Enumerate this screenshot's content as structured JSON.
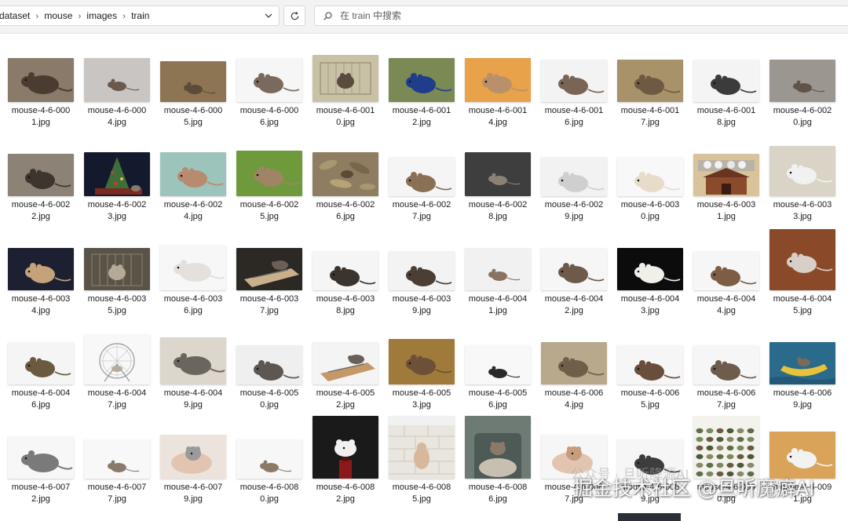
{
  "breadcrumb": [
    "dataset",
    "mouse",
    "images",
    "train"
  ],
  "search": {
    "placeholder": "在 train 中搜索"
  },
  "watermark": {
    "main": "掘金技术社区 @旦听魔癖AI",
    "faint": "公众号 · 旦听降源AI"
  },
  "files": [
    {
      "l1": "mouse-4-6-000",
      "l2": "1.jpg",
      "bg": "#8a7a69",
      "fg": "#4a3c30",
      "shape": "rat",
      "h": 56
    },
    {
      "l1": "mouse-4-6-000",
      "l2": "4.jpg",
      "bg": "#c9c5c2",
      "fg": "#6b5a4c",
      "shape": "mouse-small",
      "h": 56
    },
    {
      "l1": "mouse-4-6-000",
      "l2": "5.jpg",
      "bg": "#8d7553",
      "fg": "#5b4b38",
      "shape": "mouse-small",
      "h": 52
    },
    {
      "l1": "mouse-4-6-000",
      "l2": "6.jpg",
      "bg": "#f6f6f6",
      "fg": "#7a6a5d",
      "shape": "mouse",
      "h": 56
    },
    {
      "l1": "mouse-4-6-001",
      "l2": "0.jpg",
      "bg": "#c8c1a5",
      "fg": "#5b4a3e",
      "shape": "cage",
      "h": 60
    },
    {
      "l1": "mouse-4-6-001",
      "l2": "2.jpg",
      "bg": "#7b8a55",
      "fg": "#1f3d8a",
      "shape": "mouse",
      "h": 56
    },
    {
      "l1": "mouse-4-6-001",
      "l2": "4.jpg",
      "bg": "#e8a24a",
      "fg": "#b8906a",
      "shape": "mouse",
      "h": 56
    },
    {
      "l1": "mouse-4-6-001",
      "l2": "6.jpg",
      "bg": "#f3f3f3",
      "fg": "#7a6555",
      "shape": "mouse",
      "h": 54
    },
    {
      "l1": "mouse-4-6-001",
      "l2": "7.jpg",
      "bg": "#a8926a",
      "fg": "#6e5a44",
      "shape": "mouse",
      "h": 54
    },
    {
      "l1": "mouse-4-6-001",
      "l2": "8.jpg",
      "bg": "#f4f4f4",
      "fg": "#3b3b3b",
      "shape": "mouse",
      "h": 54
    },
    {
      "l1": "mouse-4-6-002",
      "l2": "0.jpg",
      "bg": "#9b9690",
      "fg": "#5e5448",
      "shape": "mouse-small",
      "h": 54
    },
    {
      "l1": "mouse-4-6-002",
      "l2": "2.jpg",
      "bg": "#8c8275",
      "fg": "#3d362f",
      "shape": "mouse",
      "h": 54
    },
    {
      "l1": "mouse-4-6-002",
      "l2": "3.jpg",
      "bg": "#141a2e",
      "fg": "#3f6e3a",
      "shape": "tree",
      "h": 56
    },
    {
      "l1": "mouse-4-6-002",
      "l2": "4.jpg",
      "bg": "#9cc4bb",
      "fg": "#b88a6e",
      "shape": "mouse",
      "h": 56
    },
    {
      "l1": "mouse-4-6-002",
      "l2": "5.jpg",
      "bg": "#6f9a3c",
      "fg": "#a08466",
      "shape": "mouse",
      "h": 58
    },
    {
      "l1": "mouse-4-6-002",
      "l2": "6.jpg",
      "bg": "#8f7d62",
      "fg": "#a8986f",
      "shape": "leaves",
      "h": 56
    },
    {
      "l1": "mouse-4-6-002",
      "l2": "7.jpg",
      "bg": "#f5f5f5",
      "fg": "#8a7055",
      "shape": "mouse",
      "h": 50
    },
    {
      "l1": "mouse-4-6-002",
      "l2": "8.jpg",
      "bg": "#3e3e3e",
      "fg": "#8b8275",
      "shape": "mouse-small",
      "h": 56
    },
    {
      "l1": "mouse-4-6-002",
      "l2": "9.jpg",
      "bg": "#f2f2f2",
      "fg": "#cfcfcf",
      "shape": "mouse",
      "h": 50
    },
    {
      "l1": "mouse-4-6-003",
      "l2": "0.jpg",
      "bg": "#f8f8f8",
      "fg": "#e6dcc9",
      "shape": "mouse",
      "h": 50
    },
    {
      "l1": "mouse-4-6-003",
      "l2": "1.jpg",
      "bg": "#d8c39a",
      "fg": "#8a4a2c",
      "shape": "house",
      "h": 54
    },
    {
      "l1": "mouse-4-6-003",
      "l2": "3.jpg",
      "bg": "#d9d4c6",
      "fg": "#f1f1f1",
      "shape": "mouse",
      "h": 64
    },
    {
      "l1": "mouse-4-6-003",
      "l2": "4.jpg",
      "bg": "#1c2030",
      "fg": "#c4a27a",
      "shape": "mouse",
      "h": 54
    },
    {
      "l1": "mouse-4-6-003",
      "l2": "5.jpg",
      "bg": "#5a5448",
      "fg": "#b5aa98",
      "shape": "cage",
      "h": 54
    },
    {
      "l1": "mouse-4-6-003",
      "l2": "6.jpg",
      "bg": "#f7f7f7",
      "fg": "#e4e1dc",
      "shape": "rat",
      "h": 58
    },
    {
      "l1": "mouse-4-6-003",
      "l2": "7.jpg",
      "bg": "#2c2824",
      "fg": "#c9b08a",
      "shape": "trap",
      "h": 54
    },
    {
      "l1": "mouse-4-6-003",
      "l2": "8.jpg",
      "bg": "#f5f5f5",
      "fg": "#3a332e",
      "shape": "mouse",
      "h": 50
    },
    {
      "l1": "mouse-4-6-003",
      "l2": "9.jpg",
      "bg": "#f3f3f3",
      "fg": "#4a3e35",
      "shape": "mouse",
      "h": 50
    },
    {
      "l1": "mouse-4-6-004",
      "l2": "1.jpg",
      "bg": "#f1f1f1",
      "fg": "#8a7260",
      "shape": "mouse-small",
      "h": 54
    },
    {
      "l1": "mouse-4-6-004",
      "l2": "2.jpg",
      "bg": "#f6f6f6",
      "fg": "#6d5a49",
      "shape": "mouse",
      "h": 54
    },
    {
      "l1": "mouse-4-6-004",
      "l2": "3.jpg",
      "bg": "#0c0c0c",
      "fg": "#f0efe9",
      "shape": "mouse",
      "h": 54
    },
    {
      "l1": "mouse-4-6-004",
      "l2": "4.jpg",
      "bg": "#f6f6f6",
      "fg": "#7d5e45",
      "shape": "mouse",
      "h": 50
    },
    {
      "l1": "mouse-4-6-004",
      "l2": "5.jpg",
      "bg": "#8a4a2a",
      "fg": "#d8cfc6",
      "shape": "mouse",
      "h": 78
    },
    {
      "l1": "mouse-4-6-004",
      "l2": "6.jpg",
      "bg": "#f5f5f5",
      "fg": "#6c5a40",
      "shape": "mouse",
      "h": 54
    },
    {
      "l1": "mouse-4-6-004",
      "l2": "7.jpg",
      "bg": "#f8f8f8",
      "fg": "#a6a6a6",
      "shape": "wheel",
      "h": 64
    },
    {
      "l1": "mouse-4-6-004",
      "l2": "9.jpg",
      "bg": "#dcd6cc",
      "fg": "#6b6560",
      "shape": "rat",
      "h": 60
    },
    {
      "l1": "mouse-4-6-005",
      "l2": "0.jpg",
      "bg": "#efefef",
      "fg": "#5e5650",
      "shape": "mouse",
      "h": 50
    },
    {
      "l1": "mouse-4-6-005",
      "l2": "2.jpg",
      "bg": "#f4f4f4",
      "fg": "#c49868",
      "shape": "trap",
      "h": 54
    },
    {
      "l1": "mouse-4-6-005",
      "l2": "3.jpg",
      "bg": "#a07a3a",
      "fg": "#6d5038",
      "shape": "mouse",
      "h": 58
    },
    {
      "l1": "mouse-4-6-005",
      "l2": "6.jpg",
      "bg": "#f8f8f8",
      "fg": "#2a2a2a",
      "shape": "mouse-small",
      "h": 50
    },
    {
      "l1": "mouse-4-6-006",
      "l2": "4.jpg",
      "bg": "#b8a98c",
      "fg": "#6f5e4a",
      "shape": "mouse",
      "h": 54
    },
    {
      "l1": "mouse-4-6-006",
      "l2": "5.jpg",
      "bg": "#f6f6f6",
      "fg": "#6a4e3c",
      "shape": "mouse",
      "h": 50
    },
    {
      "l1": "mouse-4-6-006",
      "l2": "7.jpg",
      "bg": "#f6f6f6",
      "fg": "#6e5c4c",
      "shape": "mouse",
      "h": 50
    },
    {
      "l1": "mouse-4-6-006",
      "l2": "9.jpg",
      "bg": "#2a6a8a",
      "fg": "#e8c23a",
      "shape": "boat",
      "h": 54
    },
    {
      "l1": "mouse-4-6-007",
      "l2": "2.jpg",
      "bg": "#f7f7f7",
      "fg": "#7a7a7a",
      "shape": "rat",
      "h": 54
    },
    {
      "l1": "mouse-4-6-007",
      "l2": "7.jpg",
      "bg": "#f8f8f8",
      "fg": "#8a7a6c",
      "shape": "mouse-small",
      "h": 50
    },
    {
      "l1": "mouse-4-6-007",
      "l2": "9.jpg",
      "bg": "#ece4dc",
      "fg": "#9a9a9a",
      "shape": "hand",
      "h": 56
    },
    {
      "l1": "mouse-4-6-008",
      "l2": "0.jpg",
      "bg": "#f7f7f7",
      "fg": "#8d7a66",
      "shape": "mouse-small",
      "h": 50
    },
    {
      "l1": "mouse-4-6-008",
      "l2": "2.jpg",
      "bg": "#1a1a1a",
      "fg": "#f0f0f0",
      "shape": "bottle",
      "h": 80
    },
    {
      "l1": "mouse-4-6-008",
      "l2": "5.jpg",
      "bg": "#f1f1f1",
      "fg": "#d8b89a",
      "shape": "bricks",
      "h": 80
    },
    {
      "l1": "mouse-4-6-008",
      "l2": "6.jpg",
      "bg": "#6e7b74",
      "fg": "#c8bfb0",
      "shape": "bag",
      "h": 80
    },
    {
      "l1": "mouse-4-6-008",
      "l2": "7.jpg",
      "bg": "#f6f6f6",
      "fg": "#c79d7e",
      "shape": "hand",
      "h": 56
    },
    {
      "l1": "mouse-4-6-008",
      "l2": "9.jpg",
      "bg": "#f6f6f6",
      "fg": "#3d3d3d",
      "shape": "mouse",
      "h": 50
    },
    {
      "l1": "mouse-4-6-009",
      "l2": "0.jpg",
      "bg": "#f4f2ec",
      "fg": "#5d6f4a",
      "shape": "chart",
      "h": 80
    },
    {
      "l1": "mouse-4-6-009",
      "l2": "1.jpg",
      "bg": "#d9a45a",
      "fg": "#f2f2f2",
      "shape": "mouse",
      "h": 60
    }
  ]
}
